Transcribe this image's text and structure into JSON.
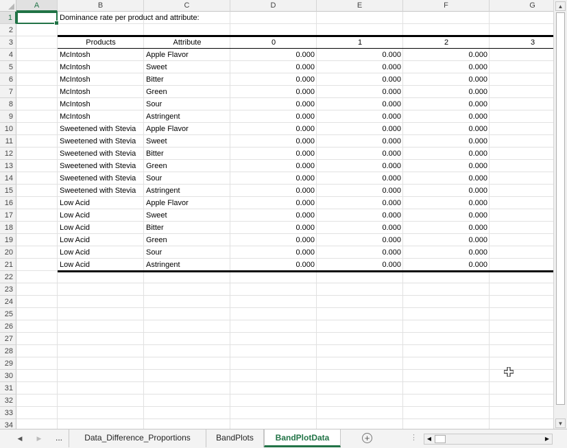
{
  "columns": [
    "A",
    "B",
    "C",
    "D",
    "E",
    "F",
    "G"
  ],
  "selected_column": "A",
  "selected_row": 1,
  "rows": [
    1,
    2,
    3,
    4,
    5,
    6,
    7,
    8,
    9,
    10,
    11,
    12,
    13,
    14,
    15,
    16,
    17,
    18,
    19,
    20,
    21,
    22,
    23,
    24,
    25,
    26,
    27,
    28,
    29,
    30,
    31,
    32,
    33,
    34
  ],
  "title": "Dominance rate per product and attribute:",
  "table": {
    "headers": [
      "Products",
      "Attribute",
      "0",
      "1",
      "2",
      "3"
    ],
    "data": [
      [
        "McIntosh",
        "Apple Flavor",
        "0.000",
        "0.000",
        "0.000"
      ],
      [
        "McIntosh",
        "Sweet",
        "0.000",
        "0.000",
        "0.000"
      ],
      [
        "McIntosh",
        "Bitter",
        "0.000",
        "0.000",
        "0.000"
      ],
      [
        "McIntosh",
        "Green",
        "0.000",
        "0.000",
        "0.000"
      ],
      [
        "McIntosh",
        "Sour",
        "0.000",
        "0.000",
        "0.000"
      ],
      [
        "McIntosh",
        "Astringent",
        "0.000",
        "0.000",
        "0.000"
      ],
      [
        "Sweetened with Stevia",
        "Apple Flavor",
        "0.000",
        "0.000",
        "0.000"
      ],
      [
        "Sweetened with Stevia",
        "Sweet",
        "0.000",
        "0.000",
        "0.000"
      ],
      [
        "Sweetened with Stevia",
        "Bitter",
        "0.000",
        "0.000",
        "0.000"
      ],
      [
        "Sweetened with Stevia",
        "Green",
        "0.000",
        "0.000",
        "0.000"
      ],
      [
        "Sweetened with Stevia",
        "Sour",
        "0.000",
        "0.000",
        "0.000"
      ],
      [
        "Sweetened with Stevia",
        "Astringent",
        "0.000",
        "0.000",
        "0.000"
      ],
      [
        "Low Acid",
        "Apple Flavor",
        "0.000",
        "0.000",
        "0.000"
      ],
      [
        "Low Acid",
        "Sweet",
        "0.000",
        "0.000",
        "0.000"
      ],
      [
        "Low Acid",
        "Bitter",
        "0.000",
        "0.000",
        "0.000"
      ],
      [
        "Low Acid",
        "Green",
        "0.000",
        "0.000",
        "0.000"
      ],
      [
        "Low Acid",
        "Sour",
        "0.000",
        "0.000",
        "0.000"
      ],
      [
        "Low Acid",
        "Astringent",
        "0.000",
        "0.000",
        "0.000"
      ]
    ]
  },
  "tabs": {
    "more": "...",
    "items": [
      "Data_Difference_Proportions",
      "BandPlots",
      "BandPlotData"
    ],
    "active": "BandPlotData"
  },
  "icons": {
    "prev_sheet": "triangle-left-icon",
    "next_sheet": "triangle-right-icon",
    "add_sheet": "plus-circle-icon",
    "cursor": "move-cross-cursor-icon"
  },
  "colors": {
    "accent": "#217346"
  }
}
